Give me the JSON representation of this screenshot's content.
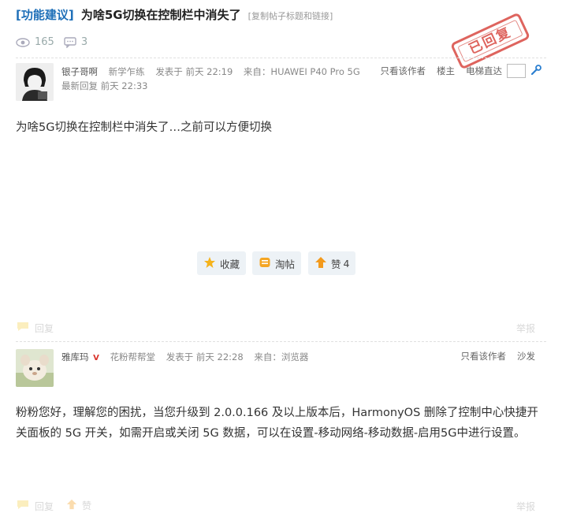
{
  "thread": {
    "category": "[功能建议]",
    "title": "为啥5G切换在控制栏中消失了",
    "copy_link": "[复制帖子标题和链接]",
    "views": "165",
    "replies": "3",
    "stamp": "已回复"
  },
  "post1": {
    "author": "银子哥啊",
    "rank": "新学乍练",
    "posted": "发表于 前天 22:19",
    "source": "来自：HUAWEI P40 Pro 5G",
    "last_reply": "最新回复 前天 22:33",
    "links": {
      "only_author": "只看该作者",
      "floor": "楼主",
      "elevator": "电梯直达"
    },
    "content": "为啥5G切换在控制栏中消失了…之前可以方便切换",
    "actions": {
      "favorite": "收藏",
      "tao": "淘帖",
      "like": "赞",
      "like_count": "4"
    },
    "reply_label": "回复",
    "report_label": "举报"
  },
  "post2": {
    "author": "雅库玛",
    "verified_mark": "V",
    "group": "花粉帮帮堂",
    "posted": "发表于 前天 22:28",
    "source": "来自：浏览器",
    "links": {
      "only_author": "只看该作者",
      "floor": "沙发"
    },
    "content": "粉粉您好，理解您的困扰，当您升级到 2.0.0.166 及以上版本后，HarmonyOS 删除了控制中心快捷开关面板的 5G 开关，如需开启或关闭 5G 数据，可以在设置-移动网络-移动数据-启用5G中进行设置。",
    "reply_label": "回复",
    "like_label": "赞",
    "report_label": "举报"
  },
  "colors": {
    "category": "#1e6fb8",
    "stamp": "#d94a42",
    "button_bg": "#edf2f6"
  }
}
